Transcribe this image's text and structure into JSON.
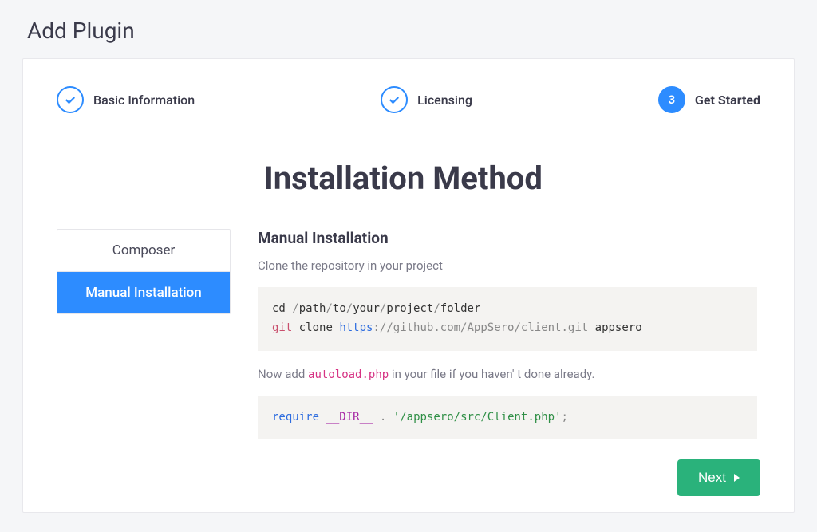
{
  "page": {
    "title": "Add Plugin"
  },
  "stepper": {
    "steps": [
      {
        "label": "Basic Information",
        "state": "done"
      },
      {
        "label": "Licensing",
        "state": "done"
      },
      {
        "label": "Get Started",
        "state": "active",
        "number": "3"
      }
    ]
  },
  "heading": "Installation Method",
  "tabs": [
    {
      "label": "Composer",
      "active": false
    },
    {
      "label": "Manual Installation",
      "active": true
    }
  ],
  "content": {
    "title": "Manual Installation",
    "intro": "Clone the repository in your project",
    "code1": {
      "line1_cd": "cd",
      "line1_path_parts": [
        "path",
        "to",
        "your",
        "project",
        "folder"
      ],
      "line2_git": "git",
      "line2_clone": "clone",
      "line2_proto": "https",
      "line2_rest": "://github.com/AppSero/client.git",
      "line2_dest": "appsero"
    },
    "para2_pre": "Now add ",
    "para2_code": "autoload.php",
    "para2_post": " in your file if you haven' t done already.",
    "code2": {
      "require": "require",
      "dir": "__DIR__",
      "dot": ".",
      "str": "'/appsero/src/Client.php'",
      "semi": ";"
    }
  },
  "buttons": {
    "next": "Next"
  }
}
